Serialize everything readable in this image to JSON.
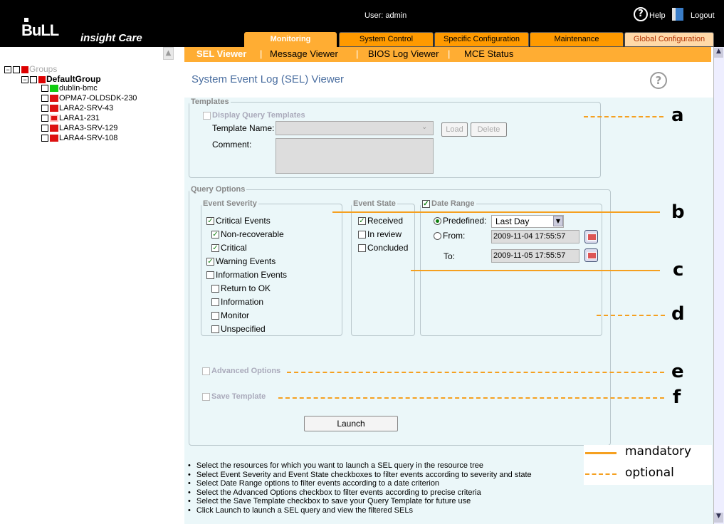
{
  "header": {
    "brand_logo": "BuLL",
    "brand_name": "insight Care",
    "user": "User: admin",
    "help": "Help",
    "logout": "Logout"
  },
  "main_tabs": [
    "Monitoring",
    "System Control",
    "Specific Configuration",
    "Maintenance",
    "Global Configuration"
  ],
  "sub_tabs": [
    "SEL Viewer",
    "Message Viewer",
    "BIOS Log Viewer",
    "MCE Status"
  ],
  "tree": {
    "root": "Groups",
    "group": "DefaultGroup",
    "items": [
      "dublin-bmc",
      "OPMA7-OLDSDK-230",
      "LARA2-SRV-43",
      "LARA1-231",
      "LARA3-SRV-129",
      "LARA4-SRV-108"
    ]
  },
  "page_title": "System Event Log (SEL) Viewer",
  "templates": {
    "legend": "Templates",
    "display": "Display Query Templates",
    "template_name": "Template Name:",
    "comment": "Comment:",
    "load": "Load",
    "delete": "Delete"
  },
  "query": {
    "legend": "Query Options",
    "severity": {
      "legend": "Event Severity",
      "items": [
        {
          "label": "Critical Events",
          "checked": true
        },
        {
          "label": "Non-recoverable",
          "checked": true
        },
        {
          "label": "Critical",
          "checked": true
        },
        {
          "label": "Warning Events",
          "checked": true
        },
        {
          "label": "Information Events",
          "checked": false
        },
        {
          "label": "Return to OK",
          "checked": false
        },
        {
          "label": "Information",
          "checked": false
        },
        {
          "label": "Monitor",
          "checked": false
        },
        {
          "label": "Unspecified",
          "checked": false
        }
      ]
    },
    "state": {
      "legend": "Event State",
      "items": [
        {
          "label": "Received",
          "checked": true
        },
        {
          "label": "In review",
          "checked": false
        },
        {
          "label": "Concluded",
          "checked": false
        }
      ]
    },
    "date": {
      "legend": "Date Range",
      "predefined": "Predefined:",
      "predefined_value": "Last Day",
      "from": "From:",
      "from_value": "2009-11-04 17:55:57",
      "to": "To:",
      "to_value": "2009-11-05 17:55:57"
    }
  },
  "advanced": "Advanced Options",
  "save_template": "Save Template",
  "launch": "Launch",
  "annotations": {
    "a": "a",
    "b": "b",
    "c": "c",
    "d": "d",
    "e": "e",
    "f": "f",
    "mandatory": "mandatory",
    "optional": "optional"
  },
  "bullets": [
    "Select the resources for which you want to launch a SEL query in the resource tree",
    "Select Event Severity and Event State checkboxes to filter events according to severity and state",
    "Select Date Range options to filter events according to a date criterion",
    "Select the Advanced Options checkbox to filter events according to precise criteria",
    "Select the Save Template checkbox to save your Query Template for future use",
    "Click Launch to launch a SEL query and view the filtered SELs"
  ],
  "colors": {
    "accent": "#ff9a00",
    "content_bg": "#ebf7f9",
    "annotation": "#f5a020",
    "title": "#4a6ea0"
  }
}
